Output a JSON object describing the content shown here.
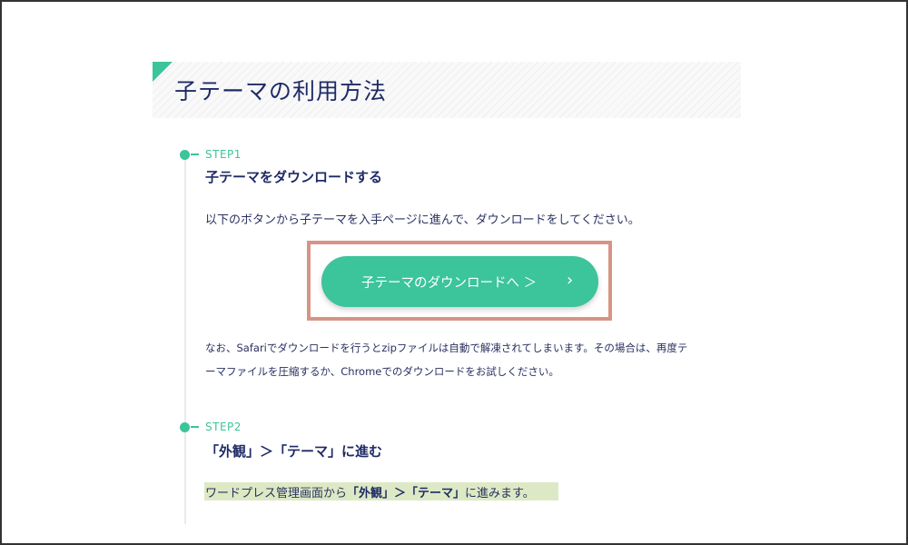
{
  "heading": {
    "title": "子テーマの利用方法"
  },
  "step1": {
    "label": "STEP1",
    "title": "子テーマをダウンロードする",
    "text": "以下のボタンから子テーマを入手ページに進んで、ダウンロードをしてください。",
    "button_label": "子テーマのダウンロードへ ＞",
    "button_chevron": "›",
    "note_line1": "なお、Safariでダウンロードを行うとzipファイルは自動で解凍されてしまいます。その場合は、再度テ",
    "note_line2": "ーマファイルを圧縮するか、Chromeでのダウンロードをお試しください。"
  },
  "step2": {
    "label": "STEP2",
    "title": "「外観」＞「テーマ」に進む",
    "text_prefix": "ワードプレス管理画面から",
    "text_bold": "「外観」＞「テーマ」",
    "text_suffix": "に進みます。"
  },
  "colors": {
    "accent": "#3cc49a",
    "title": "#1f2a66",
    "highlight_border": "#d79485",
    "marker": "#dde9c4"
  }
}
